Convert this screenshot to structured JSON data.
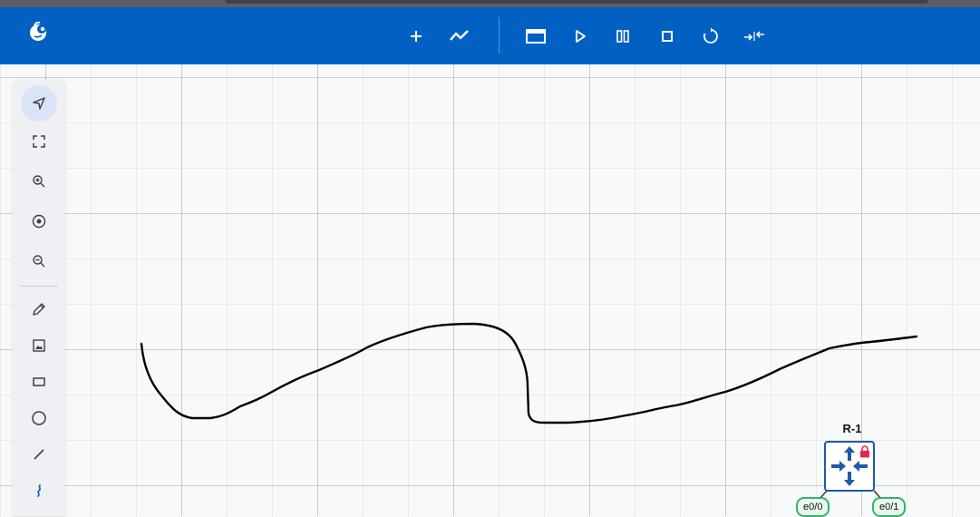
{
  "app": {
    "logo_icon": "app-logo-icon",
    "brand_color": "#0161c2"
  },
  "toolbar": {
    "buttons": [
      {
        "name": "add-node-button",
        "icon": "plus-icon"
      },
      {
        "name": "add-link-button",
        "icon": "line-chart-icon"
      },
      {
        "name": "console-button",
        "icon": "window-icon"
      },
      {
        "name": "start-button",
        "icon": "play-icon"
      },
      {
        "name": "suspend-button",
        "icon": "pause-icon"
      },
      {
        "name": "stop-button",
        "icon": "stop-icon"
      },
      {
        "name": "reload-button",
        "icon": "reload-icon"
      },
      {
        "name": "collapse-button",
        "icon": "compress-arrows-icon"
      }
    ]
  },
  "tools": [
    {
      "name": "select-tool",
      "icon": "pointer-arrow-icon",
      "active": true
    },
    {
      "name": "fit-to-screen-tool",
      "icon": "expand-corners-icon"
    },
    {
      "name": "zoom-in-tool",
      "icon": "zoom-in-icon"
    },
    {
      "name": "center-tool",
      "icon": "target-icon"
    },
    {
      "name": "zoom-out-tool",
      "icon": "zoom-out-icon"
    },
    {
      "name": "pencil-tool",
      "icon": "pencil-icon"
    },
    {
      "name": "image-tool",
      "icon": "image-icon"
    },
    {
      "name": "rectangle-tool",
      "icon": "rectangle-icon"
    },
    {
      "name": "ellipse-tool",
      "icon": "circle-icon"
    },
    {
      "name": "line-tool",
      "icon": "line-icon"
    },
    {
      "name": "freehand-tool",
      "icon": "freehand-curve-icon"
    }
  ],
  "canvas": {
    "freehand_stroke_color": "#000000"
  },
  "node": {
    "label": "R-1",
    "icon": "router-icon",
    "lock_icon": "lock-icon",
    "ports": [
      "e0/0",
      "e0/1"
    ],
    "port_color": "#34b36b",
    "icon_color": "#1f5aa8"
  }
}
